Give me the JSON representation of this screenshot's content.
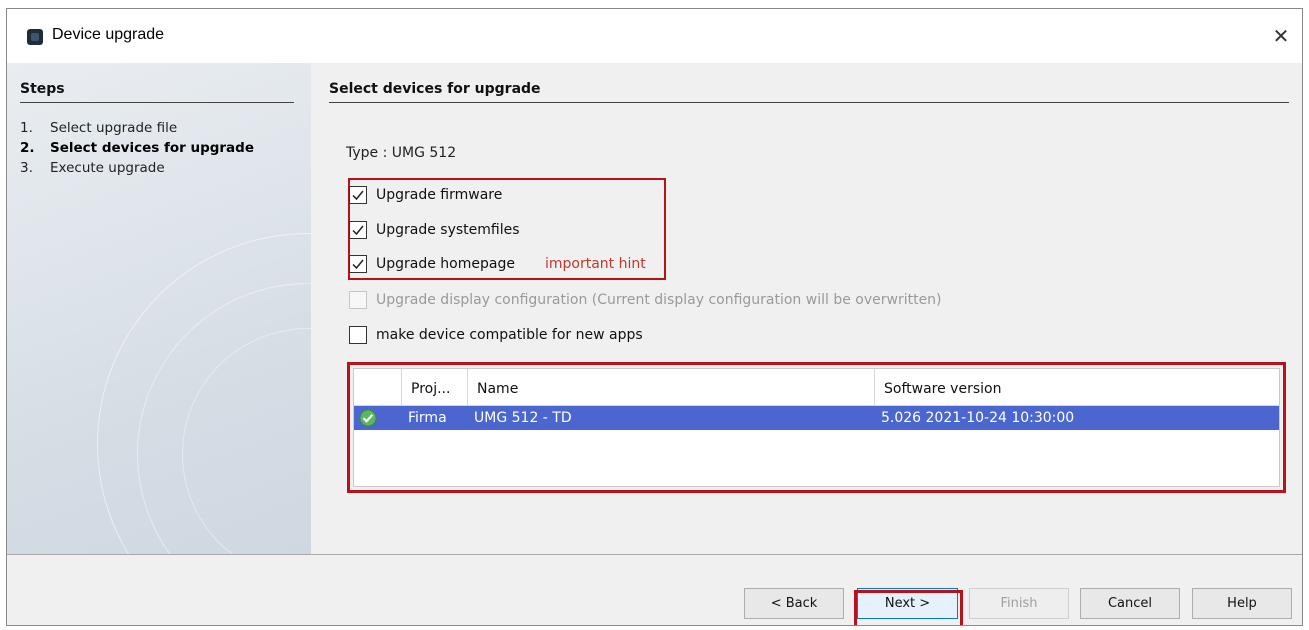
{
  "window": {
    "title": "Device upgrade",
    "close_glyph": "✕"
  },
  "steps": {
    "header": "Steps",
    "items": [
      {
        "number": "1.",
        "label": "Select upgrade file",
        "active": false
      },
      {
        "number": "2.",
        "label": "Select devices for upgrade",
        "active": true
      },
      {
        "number": "3.",
        "label": "Execute upgrade",
        "active": false
      }
    ]
  },
  "content": {
    "header": "Select devices for upgrade",
    "type_label": "Type : UMG 512",
    "options": [
      {
        "label": "Upgrade firmware",
        "checked": true,
        "enabled": true
      },
      {
        "label": "Upgrade systemfiles",
        "checked": true,
        "enabled": true
      },
      {
        "label": "Upgrade homepage",
        "checked": true,
        "enabled": true,
        "hint": "important hint"
      },
      {
        "label": "Upgrade display configuration (Current display configuration will be overwritten)",
        "checked": false,
        "enabled": false
      },
      {
        "label": "make device compatible for new apps",
        "checked": false,
        "enabled": true
      }
    ]
  },
  "table": {
    "columns": [
      "",
      "Proj...",
      "Name",
      "Software version"
    ],
    "rows": [
      {
        "status_icon": "check-circle-icon",
        "project": "Firma",
        "name": "UMG 512 - TD",
        "software_version": "5.026 2021-10-24 10:30:00",
        "selected": true
      }
    ]
  },
  "buttons": {
    "back": "< Back",
    "next": "Next >",
    "finish": "Finish",
    "cancel": "Cancel",
    "help": "Help"
  },
  "colors": {
    "highlight_border": "#b5121b",
    "selection": "#4c66d0",
    "hint_text": "#c0392b"
  }
}
